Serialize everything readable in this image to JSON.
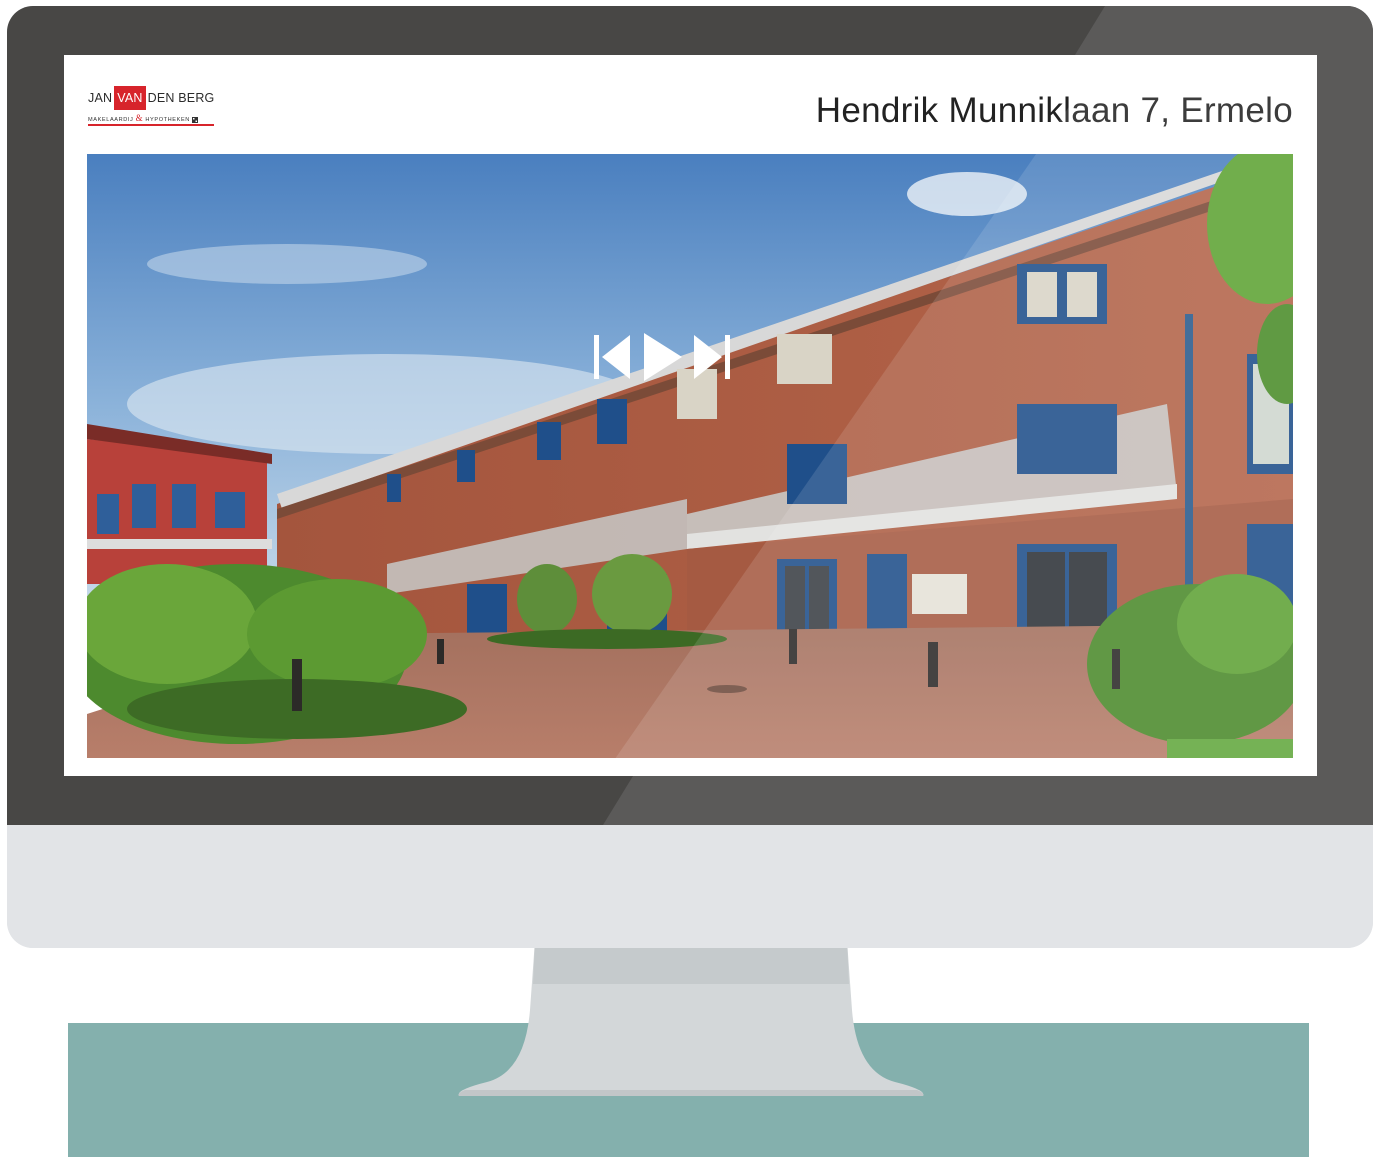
{
  "brand": {
    "logo_word_1": "JAN",
    "logo_word_2": "VAN",
    "logo_word_3": "DEN BERG",
    "logo_sub_1": "MAKELAARDIJ",
    "logo_sub_amp": "&",
    "logo_sub_2": "HYPOTHEKEN",
    "brand_color": "#d7242b"
  },
  "listing": {
    "address": "Hendrik Munniklaan 7, Ermelo"
  },
  "player": {
    "controls": [
      "skip-back-icon",
      "play-icon",
      "skip-forward-icon"
    ]
  },
  "colors": {
    "bezel": "#484745",
    "chin": "#e2e4e7",
    "desk": "#84b0ad",
    "stand": "#d3d7d9"
  }
}
